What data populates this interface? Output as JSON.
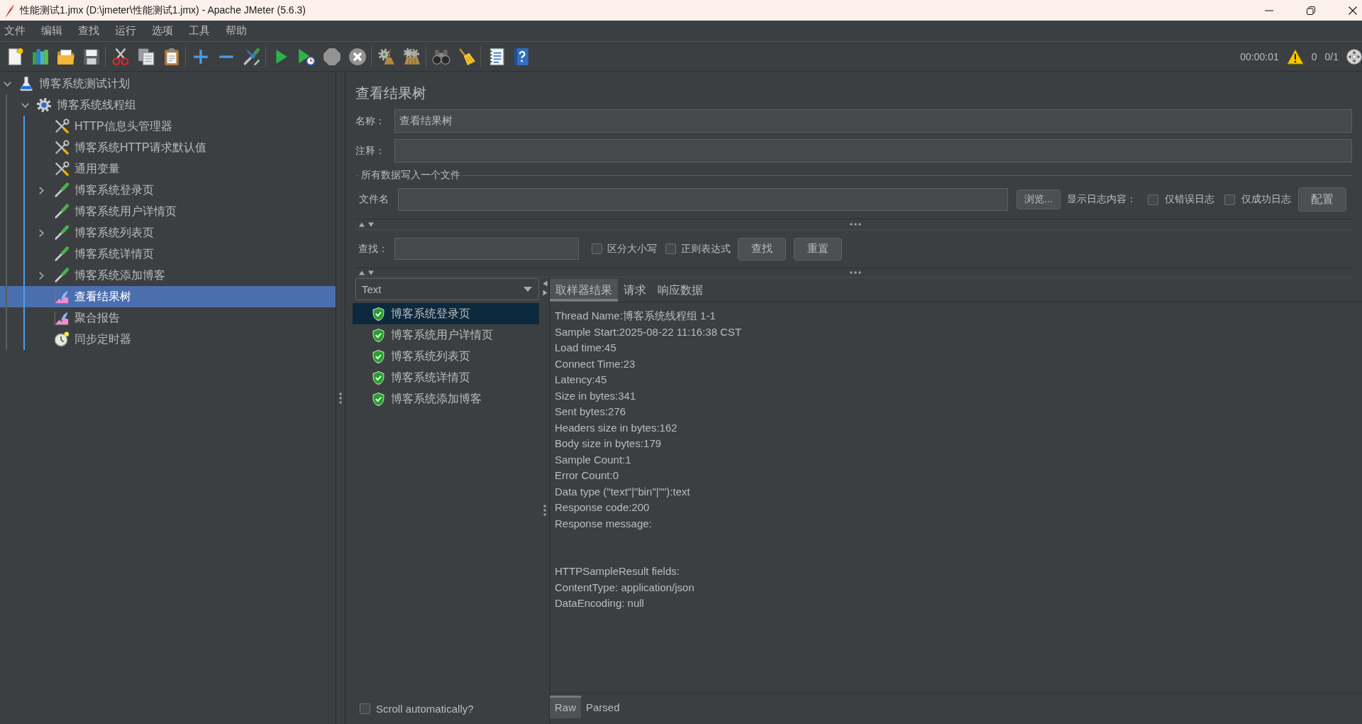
{
  "window": {
    "title": "性能测试1.jmx (D:\\jmeter\\性能测试1.jmx) - Apache JMeter (5.6.3)"
  },
  "menu": [
    "文件",
    "编辑",
    "查找",
    "运行",
    "选项",
    "工具",
    "帮助"
  ],
  "toolbar": [
    [
      {
        "kind": "new",
        "disabled": false
      },
      {
        "kind": "templates",
        "disabled": false
      },
      {
        "kind": "open",
        "disabled": false
      },
      {
        "kind": "save",
        "disabled": false
      }
    ],
    [
      {
        "kind": "cut",
        "disabled": false
      },
      {
        "kind": "copy",
        "disabled": false
      },
      {
        "kind": "paste",
        "disabled": false
      }
    ],
    [
      {
        "kind": "expand",
        "disabled": false
      },
      {
        "kind": "collapse",
        "disabled": false
      },
      {
        "kind": "toggle",
        "disabled": false
      }
    ],
    [
      {
        "kind": "start",
        "disabled": false
      },
      {
        "kind": "start-no-timers",
        "disabled": false
      },
      {
        "kind": "stop",
        "disabled": true
      },
      {
        "kind": "shutdown",
        "disabled": true
      }
    ],
    [
      {
        "kind": "clear",
        "disabled": false
      },
      {
        "kind": "clear-all",
        "disabled": false
      }
    ],
    [
      {
        "kind": "search",
        "disabled": false
      },
      {
        "kind": "reset-search",
        "disabled": false
      }
    ],
    [
      {
        "kind": "functions",
        "disabled": false
      },
      {
        "kind": "help",
        "disabled": false
      }
    ]
  ],
  "status": {
    "elapsed": "00:00:01",
    "warnings": "0",
    "threads": "0/1"
  },
  "tree": [
    {
      "label": "博客系统测试计划",
      "kind": "test-plan",
      "expanded": true,
      "selected": false,
      "children": [
        {
          "label": "博客系统线程组",
          "kind": "thread-group",
          "expanded": true,
          "selected": false,
          "children": [
            {
              "label": "HTTP信息头管理器",
              "kind": "config",
              "selected": false
            },
            {
              "label": "博客系统HTTP请求默认值",
              "kind": "config",
              "selected": false
            },
            {
              "label": "通用变量",
              "kind": "config",
              "selected": false
            },
            {
              "label": "博客系统登录页",
              "kind": "sampler",
              "expanded": false,
              "selected": false
            },
            {
              "label": "博客系统用户详情页",
              "kind": "sampler",
              "selected": false
            },
            {
              "label": "博客系统列表页",
              "kind": "sampler",
              "expanded": false,
              "selected": false
            },
            {
              "label": "博客系统详情页",
              "kind": "sampler",
              "selected": false
            },
            {
              "label": "博客系统添加博客",
              "kind": "sampler",
              "expanded": false,
              "selected": false
            },
            {
              "label": "查看结果树",
              "kind": "listener",
              "selected": true
            },
            {
              "label": "聚合报告",
              "kind": "listener",
              "selected": false
            },
            {
              "label": "同步定时器",
              "kind": "timer",
              "selected": false
            }
          ]
        }
      ]
    }
  ],
  "panel": {
    "title": "查看结果树",
    "fields": [
      {
        "label": "名称：",
        "value": "查看结果树"
      },
      {
        "label": "注释："
      }
    ],
    "file_group": {
      "title": "所有数据写入一个文件",
      "file_label": "文件名",
      "browse_button": "浏览...",
      "log_label": "显示日志内容：",
      "log_options": [
        {
          "label": "仅错误日志",
          "checked": false
        },
        {
          "label": "仅成功日志",
          "checked": false
        }
      ],
      "config_button": "配置"
    },
    "search": {
      "label": "查找：",
      "options": [
        {
          "label": "区分大小写",
          "checked": false
        },
        {
          "label": "正则表达式",
          "checked": false
        }
      ],
      "buttons": [
        "查找",
        "重置"
      ]
    }
  },
  "results": {
    "renderer": "Text",
    "samples": [
      {
        "label": "博客系统登录页",
        "success": true,
        "selected": true
      },
      {
        "label": "博客系统用户详情页",
        "success": true,
        "selected": false
      },
      {
        "label": "博客系统列表页",
        "success": true,
        "selected": false
      },
      {
        "label": "博客系统详情页",
        "success": true,
        "selected": false
      },
      {
        "label": "博客系统添加博客",
        "success": true,
        "selected": false
      }
    ],
    "scroll_auto": {
      "label": "Scroll automatically?",
      "checked": false
    }
  },
  "detail": {
    "tabs": [
      {
        "label": "取样器结果",
        "selected": true
      },
      {
        "label": "请求",
        "selected": false
      },
      {
        "label": "响应数据",
        "selected": false
      }
    ],
    "sections": [
      [
        "Thread Name:博客系统线程组 1-1",
        "Sample Start:2025-08-22 11:16:38 CST",
        "Load time:45",
        "Connect Time:23",
        "Latency:45",
        "Size in bytes:341",
        "Sent bytes:276",
        "Headers size in bytes:162",
        "Body size in bytes:179",
        "Sample Count:1",
        "Error Count:0",
        "Data type (\"text\"|\"bin\"|\"\"):text",
        "Response code:200",
        "Response message:"
      ],
      [
        "HTTPSampleResult fields:",
        "ContentType: application/json",
        "DataEncoding: null"
      ]
    ],
    "view_tabs": [
      {
        "label": "Raw",
        "selected": true
      },
      {
        "label": "Parsed",
        "selected": false
      }
    ]
  }
}
